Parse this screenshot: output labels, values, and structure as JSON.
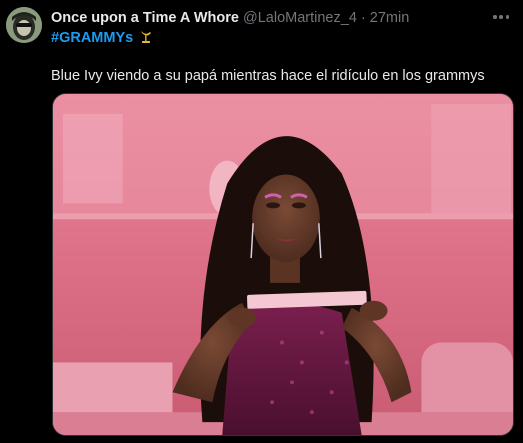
{
  "tweet": {
    "author_name": "Once upon a Time A Whore",
    "handle": "@LaloMartinez_4",
    "separator": "·",
    "time": "27min",
    "hashtag": "#GRAMMYs",
    "hashtag_icon": "grammy-gramophone-icon",
    "text": "Blue Ivy viendo a su papá mientras hace el ridículo en los grammys",
    "media_description_icon": "photo-media"
  },
  "colors": {
    "background": "#000000",
    "text": "#e7e9ea",
    "muted": "#71767b",
    "link": "#1d9bf0",
    "photo_bg": "#d86a82"
  }
}
